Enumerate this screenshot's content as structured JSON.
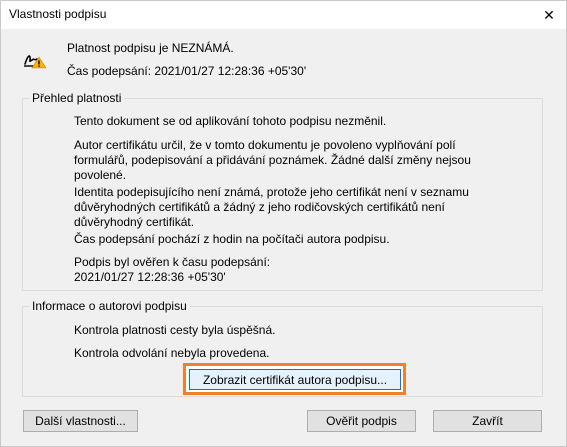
{
  "window": {
    "title": "Vlastnosti podpisu",
    "close_glyph": "✕"
  },
  "status": {
    "validity": "Platnost podpisu je NEZNÁMÁ.",
    "signing_time": "Čas podepsání:  2021/01/27 12:28:36 +05'30'"
  },
  "validity_summary": {
    "legend": "Přehled platnosti",
    "paragraphs": [
      "Tento dokument se od aplikování tohoto podpisu nezměnil.",
      "Autor certifikátu určil, že v tomto dokumentu je povoleno vyplňování polí formulářů, podepisování a přidávání poznámek. Žádné další změny nejsou povolené.",
      "Identita podepisujícího není známá, protože jeho certifikát není v seznamu důvěryhodných certifikátů a žádný z jeho rodičovských certifikátů není důvěryhodný certifikát.",
      "Čas podepsání pochází z hodin na počítači autora podpisu.",
      "Podpis byl ověřen k času podepsání:\n2021/01/27 12:28:36 +05'30'"
    ]
  },
  "signer_info": {
    "legend": "Informace o autorovi podpisu",
    "paragraphs": [
      "Kontrola platnosti cesty byla úspěšná.",
      "Kontrola odvolání nebyla provedena."
    ],
    "show_cert_button": "Zobrazit certifikát autora podpisu..."
  },
  "footer": {
    "more_properties": "Další vlastnosti...",
    "verify": "Ověřit podpis",
    "close": "Zavřít"
  },
  "colors": {
    "highlight": "#f08030",
    "warning": "#f5b400"
  },
  "icons": {
    "status": "signature-warning-icon",
    "close": "close-icon"
  }
}
